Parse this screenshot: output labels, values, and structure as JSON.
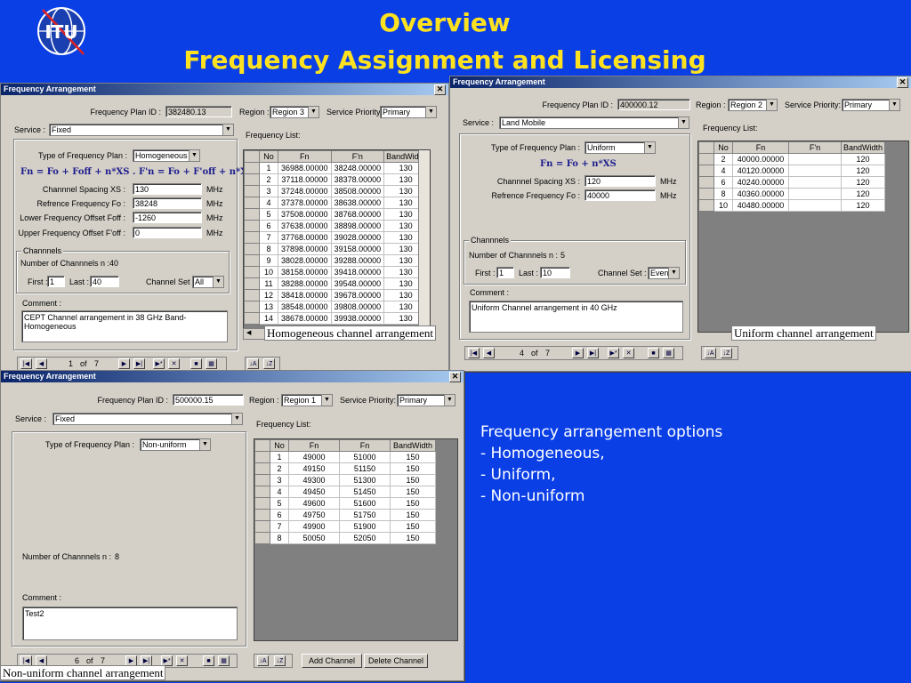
{
  "slide": {
    "title_line1": "Overview",
    "title_line2": "Frequency Assignment and Licensing",
    "logo_text": "ITU",
    "bullets": [
      "Frequency arrangement options",
      "- Homogeneous,",
      "- Uniform,",
      "- Non-uniform"
    ],
    "colors": {
      "background": "#0a3fe6",
      "title": "#ffe21f",
      "bullets": "#ffffff"
    }
  },
  "windows": {
    "homogeneous": {
      "title": "Frequency Arrangement",
      "plan_id_label": "Frequency Plan ID :",
      "plan_id": "382480.13",
      "region_label": "Region :",
      "region": "Region 3",
      "priority_label": "Service Priority:",
      "priority": "Primary",
      "service_label": "Service :",
      "service": "Fixed",
      "type_label": "Type of Frequency Plan :",
      "type": "Homogeneous",
      "formula": "Fn = Fo + Foff + n*XS . F'n = Fo + F'off + n*XS",
      "spacing_label": "Channnel Spacing  XS :",
      "spacing": "130",
      "ref_label": "Refrence Frequency  Fo :",
      "ref": "38248",
      "lower_label": "Lower Frequency Offset  Foff :",
      "lower": "-1260",
      "upper_label": "Upper Frequency Offset  F'off :",
      "upper": "0",
      "unit": "MHz",
      "channels_group": "Channnels",
      "num_label": "Number of Channnels   n :",
      "num": "40",
      "first_label": "First :",
      "first": "1",
      "last_label": "Last :",
      "last": "40",
      "set_label": "Channel Set :",
      "set": "All",
      "comment_label": "Comment :",
      "comment": "CEPT Channel arrangement in 38 GHz Band-Homogeneous",
      "list_label": "Frequency List:",
      "columns": [
        "No",
        "Fn",
        "F'n",
        "BandWidth"
      ],
      "rows": [
        [
          "1",
          "36988.00000",
          "38248.00000",
          "130"
        ],
        [
          "2",
          "37118.00000",
          "38378.00000",
          "130"
        ],
        [
          "3",
          "37248.00000",
          "38508.00000",
          "130"
        ],
        [
          "4",
          "37378.00000",
          "38638.00000",
          "130"
        ],
        [
          "5",
          "37508.00000",
          "38768.00000",
          "130"
        ],
        [
          "6",
          "37638.00000",
          "38898.00000",
          "130"
        ],
        [
          "7",
          "37768.00000",
          "39028.00000",
          "130"
        ],
        [
          "8",
          "37898.00000",
          "39158.00000",
          "130"
        ],
        [
          "9",
          "38028.00000",
          "39288.00000",
          "130"
        ],
        [
          "10",
          "38158.00000",
          "39418.00000",
          "130"
        ],
        [
          "11",
          "38288.00000",
          "39548.00000",
          "130"
        ],
        [
          "12",
          "38418.00000",
          "39678.00000",
          "130"
        ],
        [
          "13",
          "38548.00000",
          "39808.00000",
          "130"
        ],
        [
          "14",
          "38678.00000",
          "39938.00000",
          "130"
        ]
      ],
      "nav_current": "1",
      "nav_of": "of",
      "nav_total": "7",
      "caption": "Homogeneous channel arrangement"
    },
    "uniform": {
      "title": "Frequency Arrangement",
      "plan_id_label": "Frequency Plan ID :",
      "plan_id": "400000.12",
      "region_label": "Region :",
      "region": "Region 2",
      "priority_label": "Service Priority:",
      "priority": "Primary",
      "service_label": "Service :",
      "service": "Land Mobile",
      "type_label": "Type of Frequency Plan :",
      "type": "Uniform",
      "formula": "Fn = Fo + n*XS",
      "spacing_label": "Channnel Spacing  XS :",
      "spacing": "120",
      "ref_label": "Refrence Frequency  Fo :",
      "ref": "40000",
      "unit": "MHz",
      "channels_group": "Channnels",
      "num_label": "Number of Channnels   n :",
      "num": "5",
      "first_label": "First :",
      "first": "1",
      "last_label": "Last :",
      "last": "10",
      "set_label": "Channel Set :",
      "set": "Even",
      "comment_label": "Comment :",
      "comment": "Uniform Channel arrangement in 40 GHz",
      "list_label": "Frequency List:",
      "columns": [
        "No",
        "Fn",
        "F'n",
        "BandWidth"
      ],
      "rows": [
        [
          "2",
          "40000.00000",
          "",
          "120"
        ],
        [
          "4",
          "40120.00000",
          "",
          "120"
        ],
        [
          "6",
          "40240.00000",
          "",
          "120"
        ],
        [
          "8",
          "40360.00000",
          "",
          "120"
        ],
        [
          "10",
          "40480.00000",
          "",
          "120"
        ]
      ],
      "nav_current": "4",
      "nav_of": "of",
      "nav_total": "7",
      "caption": "Uniform channel arrangement"
    },
    "nonuniform": {
      "title": "Frequency Arrangement",
      "plan_id_label": "Frequency Plan ID :",
      "plan_id": "500000.15",
      "region_label": "Region :",
      "region": "Region 1",
      "priority_label": "Service Priority:",
      "priority": "Primary",
      "service_label": "Service :",
      "service": "Fixed",
      "type_label": "Type of Frequency Plan :",
      "type": "Non-uniform",
      "num_label": "Number of Channnels   n :",
      "num": "8",
      "comment_label": "Comment :",
      "comment": "Test2",
      "list_label": "Frequency List:",
      "columns": [
        "No",
        "Fn",
        "Fn",
        "BandWidth"
      ],
      "rows": [
        [
          "1",
          "49000",
          "51000",
          "150"
        ],
        [
          "2",
          "49150",
          "51150",
          "150"
        ],
        [
          "3",
          "49300",
          "51300",
          "150"
        ],
        [
          "4",
          "49450",
          "51450",
          "150"
        ],
        [
          "5",
          "49600",
          "51600",
          "150"
        ],
        [
          "6",
          "49750",
          "51750",
          "150"
        ],
        [
          "7",
          "49900",
          "51900",
          "150"
        ],
        [
          "8",
          "50050",
          "52050",
          "150"
        ]
      ],
      "nav_current": "6",
      "nav_of": "of",
      "nav_total": "7",
      "add_channel": "Add Channel",
      "delete_channel": "Delete Channel",
      "caption": "Non-uniform channel arrangement"
    }
  }
}
